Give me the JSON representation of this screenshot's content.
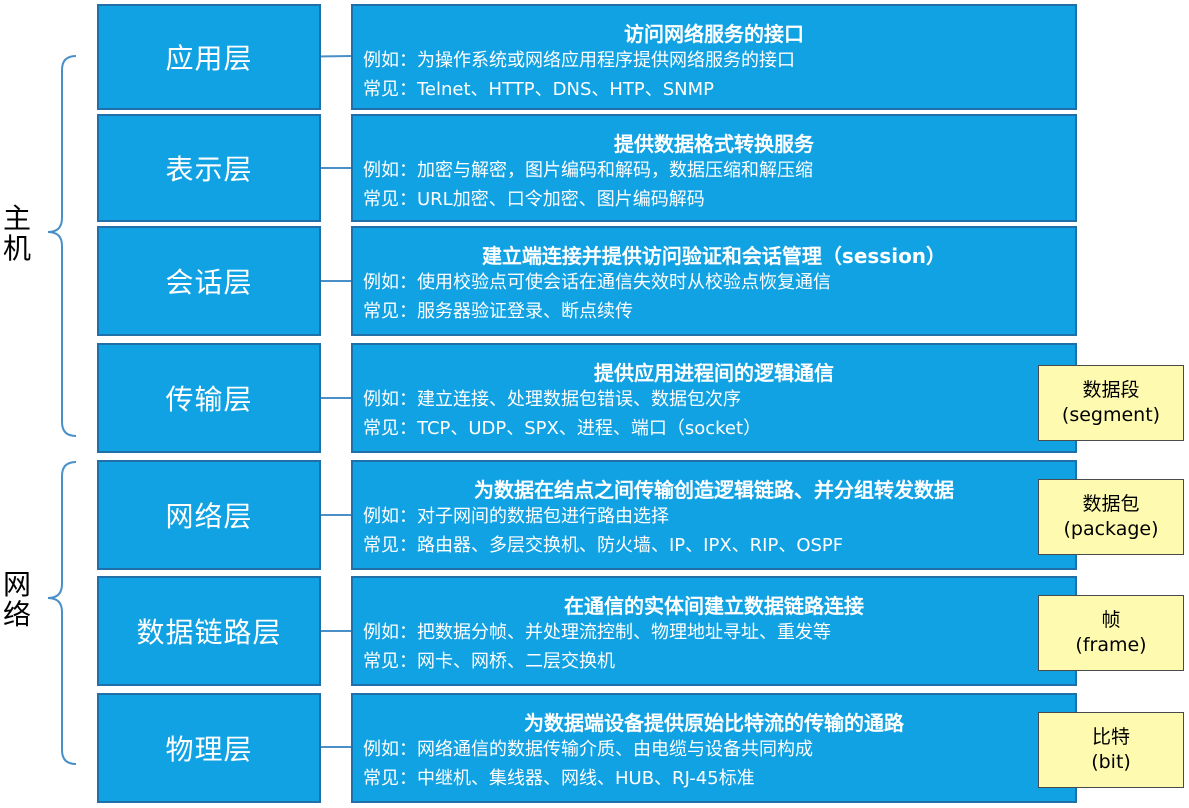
{
  "groups": [
    {
      "label_chars": [
        "主",
        "机"
      ]
    },
    {
      "label_chars": [
        "网",
        "络"
      ]
    }
  ],
  "layers": [
    {
      "name": "应用层",
      "title": "访问网络服务的接口",
      "example": "例如：为操作系统或网络应用程序提供网络服务的接口",
      "common": "常见：Telnet、HTTP、DNS、HTP、SNMP",
      "pdu": null
    },
    {
      "name": "表示层",
      "title": "提供数据格式转换服务",
      "example": "例如：加密与解密，图片编码和解码，数据压缩和解压缩",
      "common": "常见：URL加密、口令加密、图片编码解码",
      "pdu": null
    },
    {
      "name": "会话层",
      "title": "建立端连接并提供访问验证和会话管理（session）",
      "example": "例如：使用校验点可使会话在通信失效时从校验点恢复通信",
      "common": "常见：服务器验证登录、断点续传",
      "pdu": null
    },
    {
      "name": "传输层",
      "title": "提供应用进程间的逻辑通信",
      "example": "例如：建立连接、处理数据包错误、数据包次序",
      "common": "常见：TCP、UDP、SPX、进程、端口（socket）",
      "pdu": {
        "line1": "数据段",
        "line2": "(segment)"
      }
    },
    {
      "name": "网络层",
      "title": "为数据在结点之间传输创造逻辑链路、并分组转发数据",
      "example": "例如：对子网间的数据包进行路由选择",
      "common": "常见：路由器、多层交换机、防火墙、IP、IPX、RIP、OSPF",
      "pdu": {
        "line1": "数据包",
        "line2": "(package)"
      }
    },
    {
      "name": "数据链路层",
      "title": "在通信的实体间建立数据链路连接",
      "example": "例如：把数据分帧、并处理流控制、物理地址寻址、重发等",
      "common": "常见：网卡、网桥、二层交换机",
      "pdu": {
        "line1": "帧",
        "line2": "(frame)"
      }
    },
    {
      "name": "物理层",
      "title": "为数据端设备提供原始比特流的传输的通路",
      "example": "例如：网络通信的数据传输介质、由电缆与设备共同构成",
      "common": "常见：中继机、集线器、网线、HUB、RJ-45标准",
      "pdu": {
        "line1": "比特",
        "line2": "(bit)"
      }
    }
  ],
  "colors": {
    "box_fill": "#11a2e3",
    "box_border": "#1f6fa8",
    "pdu_fill": "#fefbb0",
    "bracket": "#4a90c8"
  }
}
